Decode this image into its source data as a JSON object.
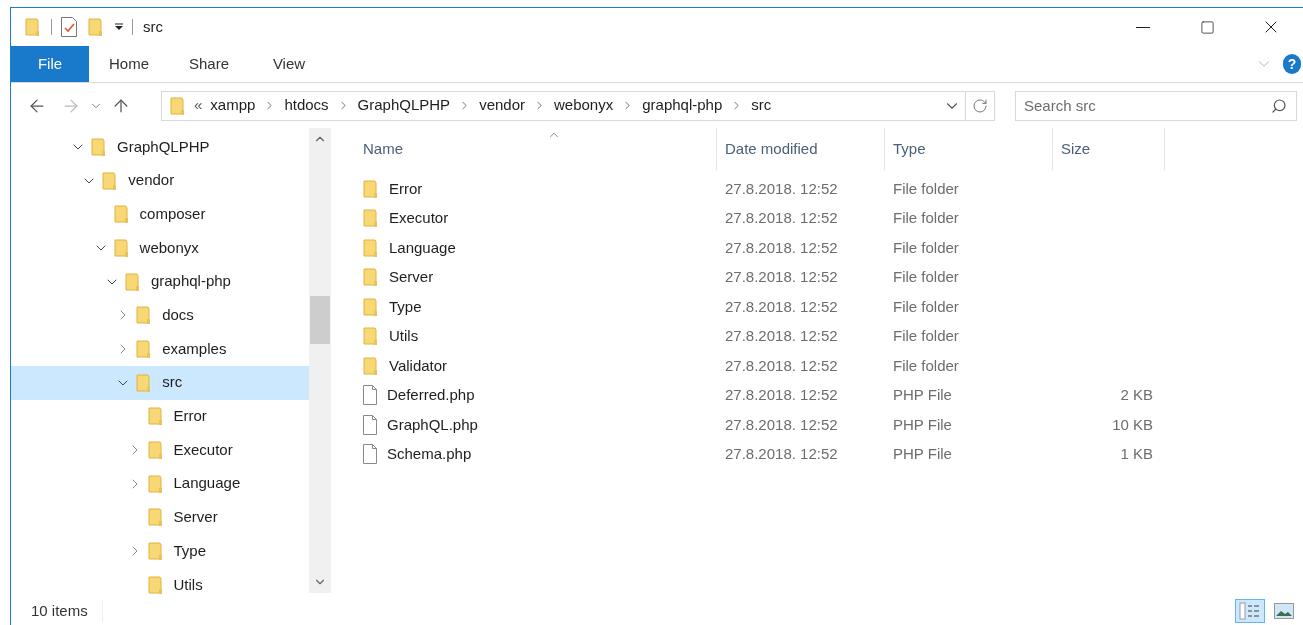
{
  "window": {
    "title": "src"
  },
  "ribbon_tabs": [
    {
      "label": "File",
      "selected": true
    },
    {
      "label": "Home",
      "selected": false
    },
    {
      "label": "Share",
      "selected": false
    },
    {
      "label": "View",
      "selected": false
    }
  ],
  "address": {
    "overflow": "«",
    "crumbs": [
      "xampp",
      "htdocs",
      "GraphQLPHP",
      "vendor",
      "webonyx",
      "graphql-php",
      "src"
    ]
  },
  "search": {
    "placeholder": "Search src"
  },
  "help": "?",
  "tree": [
    {
      "label": "GraphQLPHP",
      "expandable": true,
      "expanded": true,
      "selected": false,
      "children": [
        {
          "label": "vendor",
          "expandable": true,
          "expanded": true,
          "selected": false,
          "children": [
            {
              "label": "composer",
              "expandable": false,
              "expanded": false,
              "selected": false
            },
            {
              "label": "webonyx",
              "expandable": true,
              "expanded": true,
              "selected": false,
              "children": [
                {
                  "label": "graphql-php",
                  "expandable": true,
                  "expanded": true,
                  "selected": false,
                  "children": [
                    {
                      "label": "docs",
                      "expandable": true,
                      "expanded": false,
                      "selected": false
                    },
                    {
                      "label": "examples",
                      "expandable": true,
                      "expanded": false,
                      "selected": false
                    },
                    {
                      "label": "src",
                      "expandable": true,
                      "expanded": true,
                      "selected": true,
                      "children": [
                        {
                          "label": "Error",
                          "expandable": false,
                          "expanded": false,
                          "selected": false
                        },
                        {
                          "label": "Executor",
                          "expandable": true,
                          "expanded": false,
                          "selected": false
                        },
                        {
                          "label": "Language",
                          "expandable": true,
                          "expanded": false,
                          "selected": false
                        },
                        {
                          "label": "Server",
                          "expandable": false,
                          "expanded": false,
                          "selected": false
                        },
                        {
                          "label": "Type",
                          "expandable": true,
                          "expanded": false,
                          "selected": false
                        },
                        {
                          "label": "Utils",
                          "expandable": false,
                          "expanded": false,
                          "selected": false
                        }
                      ]
                    }
                  ]
                }
              ]
            }
          ]
        }
      ]
    }
  ],
  "table": {
    "columns": [
      "Name",
      "Date modified",
      "Type",
      "Size"
    ],
    "rows": [
      {
        "kind": "folder",
        "name": "Error",
        "date": "27.8.2018. 12:52",
        "type": "File folder"
      },
      {
        "kind": "folder",
        "name": "Executor",
        "date": "27.8.2018. 12:52",
        "type": "File folder"
      },
      {
        "kind": "folder",
        "name": "Language",
        "date": "27.8.2018. 12:52",
        "type": "File folder"
      },
      {
        "kind": "folder",
        "name": "Server",
        "date": "27.8.2018. 12:52",
        "type": "File folder"
      },
      {
        "kind": "folder",
        "name": "Type",
        "date": "27.8.2018. 12:52",
        "type": "File folder"
      },
      {
        "kind": "folder",
        "name": "Utils",
        "date": "27.8.2018. 12:52",
        "type": "File folder"
      },
      {
        "kind": "folder",
        "name": "Validator",
        "date": "27.8.2018. 12:52",
        "type": "File folder"
      },
      {
        "kind": "file",
        "name": "Deferred.php",
        "date": "27.8.2018. 12:52",
        "type": "PHP File",
        "size": "2 KB"
      },
      {
        "kind": "file",
        "name": "GraphQL.php",
        "date": "27.8.2018. 12:52",
        "type": "PHP File",
        "size": "10 KB"
      },
      {
        "kind": "file",
        "name": "Schema.php",
        "date": "27.8.2018. 12:52",
        "type": "PHP File",
        "size": "1 KB"
      }
    ]
  },
  "status_bar": {
    "count": "10 items"
  },
  "view_buttons": [
    {
      "kind": "details",
      "selected": true
    },
    {
      "kind": "thumbnails",
      "selected": false
    }
  ]
}
